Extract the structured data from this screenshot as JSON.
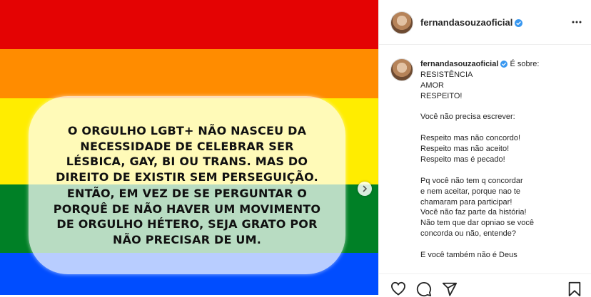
{
  "post": {
    "username": "fernandasouzaoficial",
    "verified": true,
    "image_text": {
      "paragraph1": [
        "O ORGULHO LGBT+ NÃO NASCEU DA",
        "NECESSIDADE DE CELEBRAR SER",
        "LÉSBICA, GAY, BI OU TRANS. MAS DO",
        "DIREITO DE EXISTIR SEM PERSEGUIÇÃO."
      ],
      "paragraph2": [
        "ENTÃO, EM VEZ DE SE PERGUNTAR O",
        "PORQUÊ DE NÃO HAVER UM MOVIMENTO",
        "DE ORGULHO HÉTERO, SEJA GRATO POR",
        "NÃO PRECISAR DE UM."
      ]
    },
    "flag_colors": [
      "#e40303",
      "#ff8c00",
      "#ffed00",
      "#008026",
      "#004dff",
      "#750787"
    ]
  },
  "header": {
    "username": "fernandasouzaoficial",
    "more_icon": "more-horizontal-icon"
  },
  "caption": {
    "username": "fernandasouzaoficial",
    "first_line": " É sobre:",
    "lines": [
      "RESISTÊNCIA",
      "AMOR",
      "RESPEITO!",
      "",
      "Você não precisa escrever:",
      "",
      "Respeito mas não concordo!",
      "Respeito mas não aceito!",
      "Respeito mas é pecado!",
      "",
      "Pq você não tem q concordar",
      "e nem aceitar, porque nao te",
      "chamaram para participar!",
      "Você não faz parte da história!",
      "Não tem que dar opniao se você",
      "concorda ou não, entende?",
      "",
      "E você também não é Deus"
    ]
  },
  "actions": {
    "icons": [
      "heart-icon",
      "comment-icon",
      "share-icon",
      "bookmark-icon"
    ]
  }
}
